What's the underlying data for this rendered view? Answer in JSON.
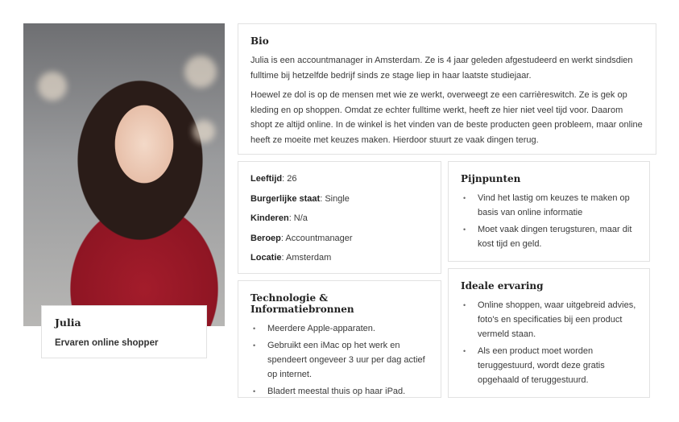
{
  "persona": {
    "name": "Julia",
    "role": "Ervaren online shopper"
  },
  "bio": {
    "title": "Bio",
    "paragraphs": [
      "Julia is een accountmanager in Amsterdam. Ze is 4 jaar geleden afgestudeerd en werkt sindsdien fulltime bij hetzelfde bedrijf sinds ze stage liep in haar laatste studiejaar.",
      "Hoewel ze dol is op de mensen met wie ze werkt, overweegt ze een carrièreswitch. Ze is gek op kleding en op shoppen. Omdat ze echter fulltime werkt, heeft ze hier niet veel tijd voor. Daarom shopt ze altijd online. In de winkel is het vinden van de beste producten geen probleem, maar online heeft ze moeite met keuzes maken. Hierdoor stuurt ze vaak dingen terug."
    ]
  },
  "facts": [
    {
      "label": "Leeftijd",
      "value": ": 26"
    },
    {
      "label": "Burgerlijke staat",
      "value": ": Single"
    },
    {
      "label": "Kinderen",
      "value": ": N/a"
    },
    {
      "label": "Beroep",
      "value": ": Accountmanager"
    },
    {
      "label": "Locatie",
      "value": ": Amsterdam"
    }
  ],
  "tech": {
    "title": "Technologie & Informatiebronnen",
    "items": [
      "Meerdere Apple-apparaten.",
      "Gebruikt een iMac op het werk en spendeert ongeveer 3 uur per dag actief op internet.",
      "Bladert meestal thuis op haar iPad."
    ]
  },
  "pain": {
    "title": "Pijnpunten",
    "items": [
      "Vind het lastig om keuzes te maken op basis van online informatie",
      "Moet vaak dingen terugsturen, maar dit kost tijd en geld."
    ]
  },
  "ideal": {
    "title": "Ideale ervaring",
    "items": [
      "Online shoppen, waar uitgebreid advies, foto's en specificaties bij een product vermeld staan.",
      "Als een product moet worden teruggestuurd, wordt deze gratis opgehaald of teruggestuurd."
    ]
  }
}
